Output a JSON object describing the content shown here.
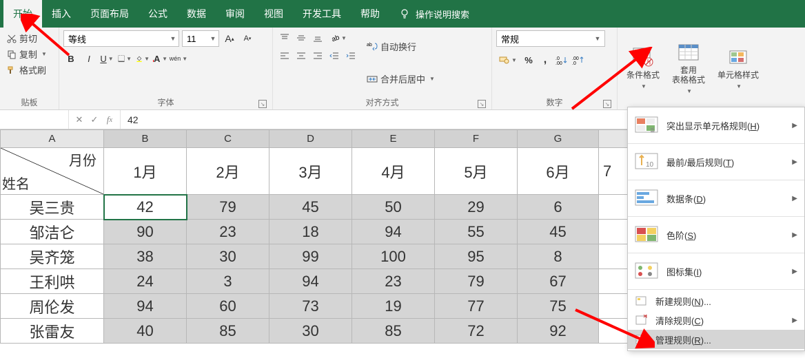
{
  "tabs": [
    "开始",
    "插入",
    "页面布局",
    "公式",
    "数据",
    "审阅",
    "视图",
    "开发工具",
    "帮助"
  ],
  "active_tab": 0,
  "tell_me": "操作说明搜索",
  "clipboard": {
    "cut": "剪切",
    "copy": "复制",
    "format_painter": "格式刷",
    "label": "贴板"
  },
  "font": {
    "name": "等线",
    "size": "11",
    "label": "字体"
  },
  "align": {
    "wrap": "自动换行",
    "merge": "合并后居中",
    "label": "对齐方式"
  },
  "number": {
    "format": "常规",
    "label": "数字"
  },
  "styles": {
    "conditional": "条件格式",
    "table": "套用\n表格格式",
    "cell": "单元格样式"
  },
  "formula_bar": {
    "name_box": "",
    "value": "42"
  },
  "columns": [
    "A",
    "B",
    "C",
    "D",
    "E",
    "F",
    "G",
    ""
  ],
  "header_top": "月份",
  "header_bottom": "姓名",
  "months": [
    "1月",
    "2月",
    "3月",
    "4月",
    "5月",
    "6月",
    "7"
  ],
  "rows": [
    {
      "name": "吴三贵",
      "values": [
        "42",
        "79",
        "45",
        "50",
        "29",
        "6",
        ""
      ]
    },
    {
      "name": "邹洁仑",
      "values": [
        "90",
        "23",
        "18",
        "94",
        "55",
        "45",
        ""
      ]
    },
    {
      "name": "吴齐笼",
      "values": [
        "38",
        "30",
        "99",
        "100",
        "95",
        "8",
        ""
      ]
    },
    {
      "name": "王利哄",
      "values": [
        "24",
        "3",
        "94",
        "23",
        "79",
        "67",
        ""
      ]
    },
    {
      "name": "周伦发",
      "values": [
        "94",
        "60",
        "73",
        "19",
        "77",
        "75",
        ""
      ]
    },
    {
      "name": "张雷友",
      "values": [
        "40",
        "85",
        "30",
        "85",
        "72",
        "92",
        ""
      ]
    }
  ],
  "dropdown": {
    "highlight": "突出显示单元格规则(",
    "highlight_key": "H",
    "top": "最前/最后规则(",
    "top_key": "T",
    "databar": "数据条(",
    "databar_key": "D",
    "colorscale": "色阶(",
    "colorscale_key": "S",
    "iconset": "图标集(",
    "iconset_key": "I",
    "newrule": "新建规则(",
    "newrule_key": "N",
    "clear": "清除规则(",
    "clear_key": "C",
    "manage": "管理规则(",
    "manage_key": "R"
  },
  "colors": {
    "brand": "#217346",
    "arrow": "#ff0000"
  }
}
